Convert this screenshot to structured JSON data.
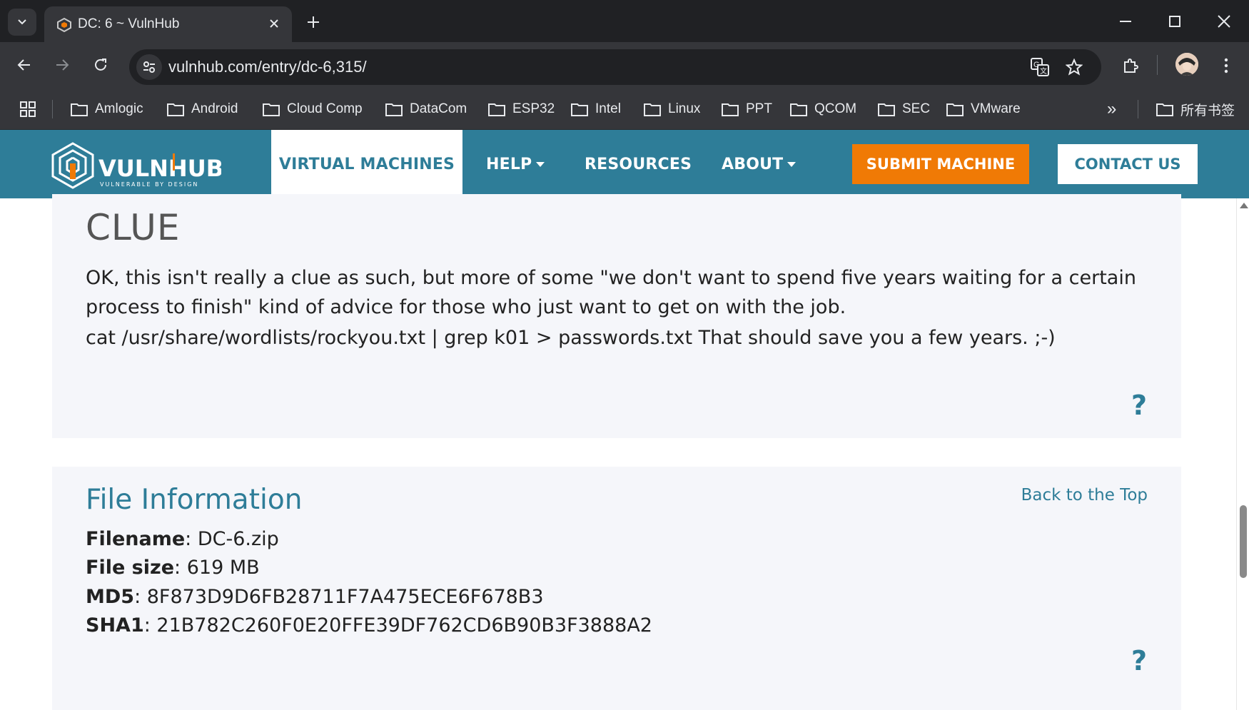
{
  "browser": {
    "tab_title": "DC: 6 ~ VulnHub",
    "url": "vulnhub.com/entry/dc-6,315/",
    "bookmarks": [
      "Amlogic",
      "Android",
      "Cloud Comp",
      "DataCom",
      "ESP32",
      "Intel",
      "Linux",
      "PPT",
      "QCOM",
      "SEC",
      "VMware"
    ],
    "all_bookmarks": "所有书签",
    "overflow": "»"
  },
  "site": {
    "logo_text": "VULNHUB",
    "logo_tagline": "VULNERABLE BY DESIGN",
    "nav": {
      "virtual_machines": "VIRTUAL MACHINES",
      "help": "HELP",
      "resources": "RESOURCES",
      "about": "ABOUT",
      "submit": "SUBMIT MACHINE",
      "contact": "CONTACT US"
    }
  },
  "clue": {
    "title": "CLUE",
    "paragraph1": "OK, this isn't really a clue as such, but more of some \"we don't want to spend five years waiting for a certain process to finish\" kind of advice for those who just want to get on with the job.",
    "paragraph2": "cat /usr/share/wordlists/rockyou.txt | grep k01 > passwords.txt That should save you a few years. ;-)",
    "help_mark": "?"
  },
  "file_info": {
    "title": "File Information",
    "back_to_top": "Back to the Top",
    "filename_label": "Filename",
    "filename": ": DC-6.zip",
    "filesize_label": "File size",
    "filesize": ": 619 MB",
    "md5_label": "MD5",
    "md5": ": 8F873D9D6FB28711F7A475ECE6F678B3",
    "sha1_label": "SHA1",
    "sha1": ": 21B782C260F0E20FFE39DF762CD6B90B3F3888A2",
    "help_mark": "?"
  },
  "colors": {
    "brand_teal": "#2e7d98",
    "submit_orange": "#f07a05",
    "panel_bg": "#f5f6fa"
  }
}
